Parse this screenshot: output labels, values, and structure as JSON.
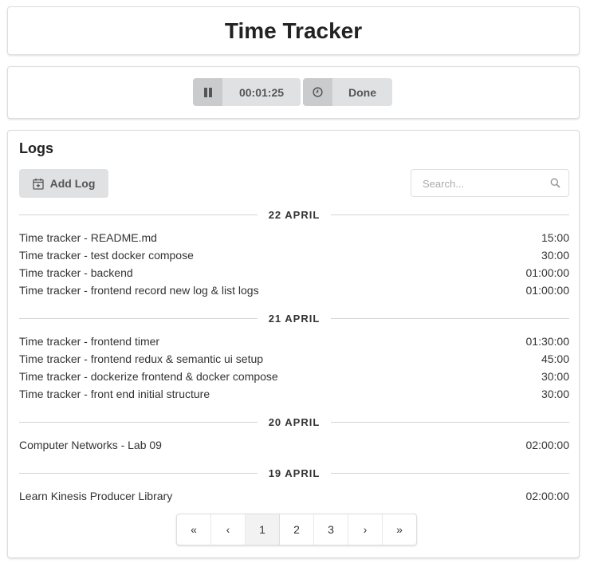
{
  "app": {
    "title": "Time Tracker"
  },
  "timer": {
    "time": "00:01:25",
    "done_label": "Done"
  },
  "logs": {
    "heading": "Logs",
    "add_label": "Add Log",
    "search_placeholder": "Search...",
    "groups": [
      {
        "date": "22 APRIL",
        "entries": [
          {
            "name": "Time tracker - README.md",
            "duration": "15:00"
          },
          {
            "name": "Time tracker - test docker compose",
            "duration": "30:00"
          },
          {
            "name": "Time tracker - backend",
            "duration": "01:00:00"
          },
          {
            "name": "Time tracker - frontend record new log & list logs",
            "duration": "01:00:00"
          }
        ]
      },
      {
        "date": "21 APRIL",
        "entries": [
          {
            "name": "Time tracker - frontend timer",
            "duration": "01:30:00"
          },
          {
            "name": "Time tracker - frontend redux & semantic ui setup",
            "duration": "45:00"
          },
          {
            "name": "Time tracker - dockerize frontend & docker compose",
            "duration": "30:00"
          },
          {
            "name": "Time tracker - front end initial structure",
            "duration": "30:00"
          }
        ]
      },
      {
        "date": "20 APRIL",
        "entries": [
          {
            "name": "Computer Networks - Lab 09",
            "duration": "02:00:00"
          }
        ]
      },
      {
        "date": "19 APRIL",
        "entries": [
          {
            "name": "Learn Kinesis Producer Library",
            "duration": "02:00:00"
          }
        ]
      }
    ]
  },
  "pagination": {
    "first": "«",
    "prev": "‹",
    "pages": [
      "1",
      "2",
      "3"
    ],
    "next": "›",
    "last": "»",
    "active_page": "1"
  }
}
